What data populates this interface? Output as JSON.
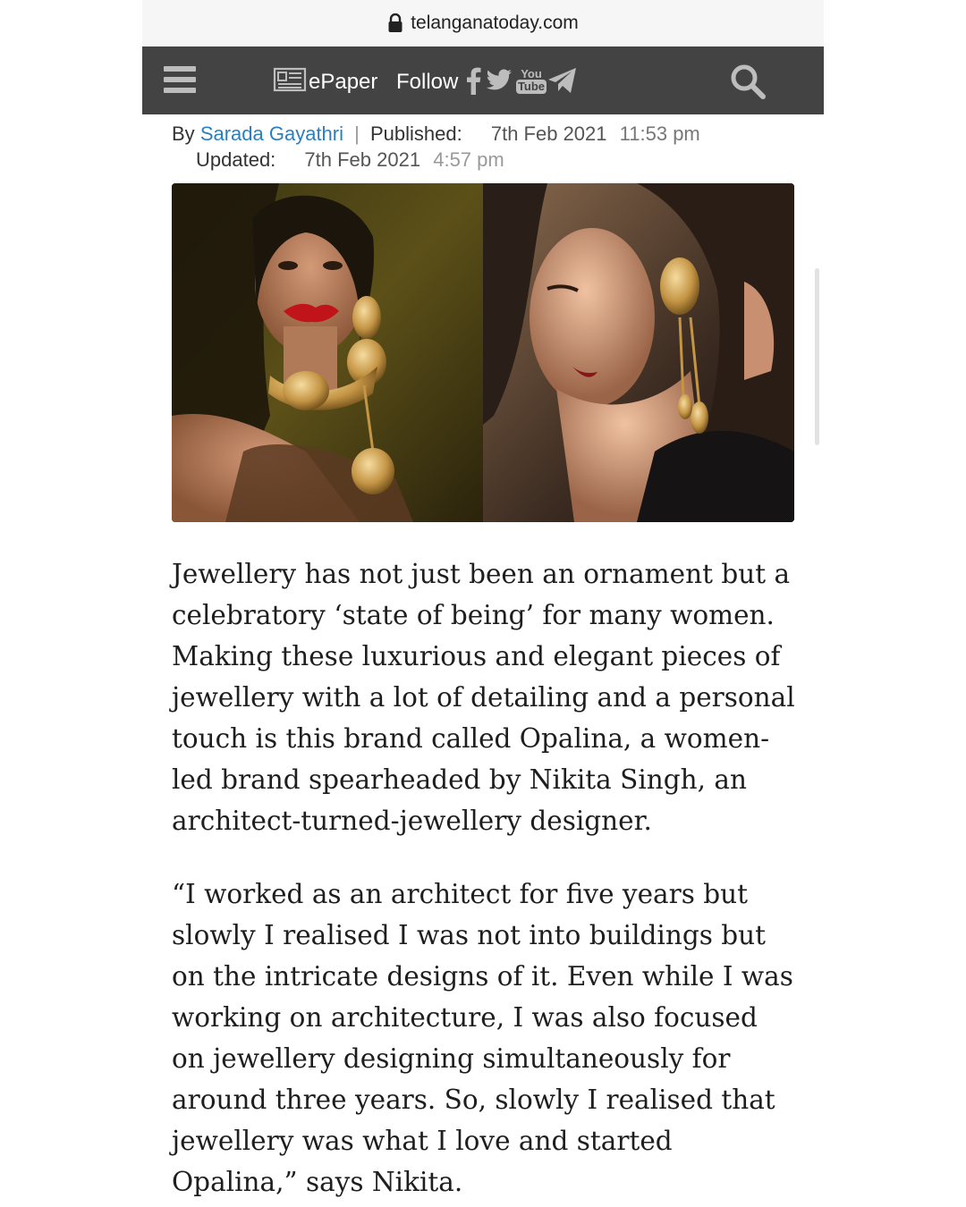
{
  "browser": {
    "url": "telanganatoday.com"
  },
  "header": {
    "epaper_label": "ePaper",
    "follow_label": "Follow",
    "social_icons": [
      "facebook-icon",
      "twitter-icon",
      "youtube-icon",
      "telegram-icon"
    ],
    "youtube_text_top": "You",
    "youtube_text_bottom": "Tube",
    "background_color": "#434343"
  },
  "byline": {
    "by": "By",
    "author": "Sarada Gayathri",
    "separator": "|",
    "published_label": "Published:",
    "published_date": "7th Feb 2021",
    "published_time": "11:53 pm",
    "updated_label": "Updated:",
    "updated_date": "7th Feb 2021",
    "updated_time": "4:57 pm",
    "author_color": "#2a7fc0"
  },
  "article": {
    "paragraphs": [
      "Jewellery has not just been an ornament but a celebratory ‘state of being’ for many women. Making these luxurious and elegant pieces of jewellery with a lot of detailing and a personal touch is this brand called Opalina, a women-led brand spearheaded by Nikita Singh, an architect-turned-jewellery designer.",
      "“I worked as an architect for five years but slowly I realised I was not into buildings but on the intricate designs of it. Even while I was working on architecture, I was also focused on jewellery designing simultaneously for around three years. So, slowly I realised that jewellery was what I love and started Opalina,” says Nikita."
    ]
  }
}
